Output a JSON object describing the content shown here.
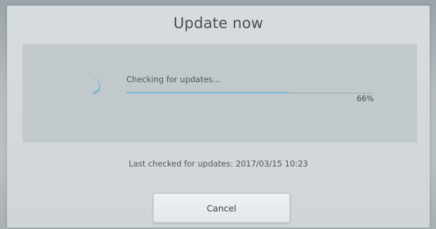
{
  "dialog": {
    "title": "Update now",
    "status_text": "Checking for updates...",
    "progress": 0.66,
    "progress_label": "66%",
    "last_checked": "Last checked for updates: 2017/03/15 10:23",
    "cancel_label": "Cancel"
  },
  "icons": {
    "spinner": "loading-spinner-icon"
  },
  "colors": {
    "progress_fill": "#7ab6d1",
    "spinner": "#6fb2d4"
  }
}
